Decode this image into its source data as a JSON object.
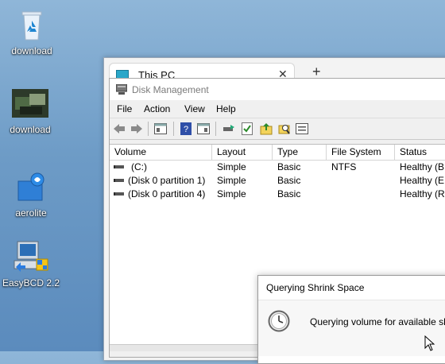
{
  "desktop": {
    "icons": [
      {
        "label": "download",
        "kind": "recycle-bin"
      },
      {
        "label": "download",
        "kind": "photo"
      },
      {
        "label": "aerolite",
        "kind": "app"
      },
      {
        "label": "EasyBCD 2.2",
        "kind": "installer"
      }
    ]
  },
  "explorer": {
    "tab_title": "This PC",
    "close_glyph": "✕",
    "new_tab_glyph": "+"
  },
  "disk_management": {
    "title": "Disk Management",
    "menu": [
      "File",
      "Action",
      "View",
      "Help"
    ],
    "columns": [
      "Volume",
      "Layout",
      "Type",
      "File System",
      "Status"
    ],
    "rows": [
      {
        "volume": "(C:)",
        "layout": "Simple",
        "type": "Basic",
        "fs": "NTFS",
        "status": "Healthy (B..."
      },
      {
        "volume": "(Disk 0 partition 1)",
        "layout": "Simple",
        "type": "Basic",
        "fs": "",
        "status": "Healthy (E..."
      },
      {
        "volume": "(Disk 0 partition 4)",
        "layout": "Simple",
        "type": "Basic",
        "fs": "",
        "status": "Healthy (R..."
      }
    ]
  },
  "dialog": {
    "title": "Querying Shrink Space",
    "message": "Querying volume for available shrink"
  },
  "colors": {
    "desktop": "#6d9bc6",
    "accent": "#2aa7c9"
  }
}
